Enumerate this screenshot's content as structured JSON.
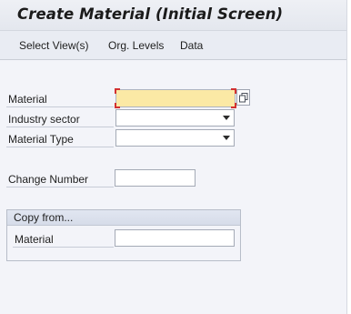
{
  "title": "Create Material (Initial Screen)",
  "menu": [
    {
      "label": "Select View(s)"
    },
    {
      "label": "Org. Levels"
    },
    {
      "label": "Data"
    }
  ],
  "fields": {
    "material": {
      "label": "Material",
      "value": ""
    },
    "industry_sector": {
      "label": "Industry sector",
      "value": ""
    },
    "material_type": {
      "label": "Material Type",
      "value": ""
    },
    "change_number": {
      "label": "Change Number",
      "value": ""
    }
  },
  "copy_from": {
    "title": "Copy from...",
    "material": {
      "label": "Material",
      "value": ""
    }
  },
  "icons": {
    "f4_help": "value-help-icon",
    "dropdown": "chevron-down-icon"
  },
  "colors": {
    "required_field": "#fbe9a5",
    "required_marker": "#d23131"
  }
}
